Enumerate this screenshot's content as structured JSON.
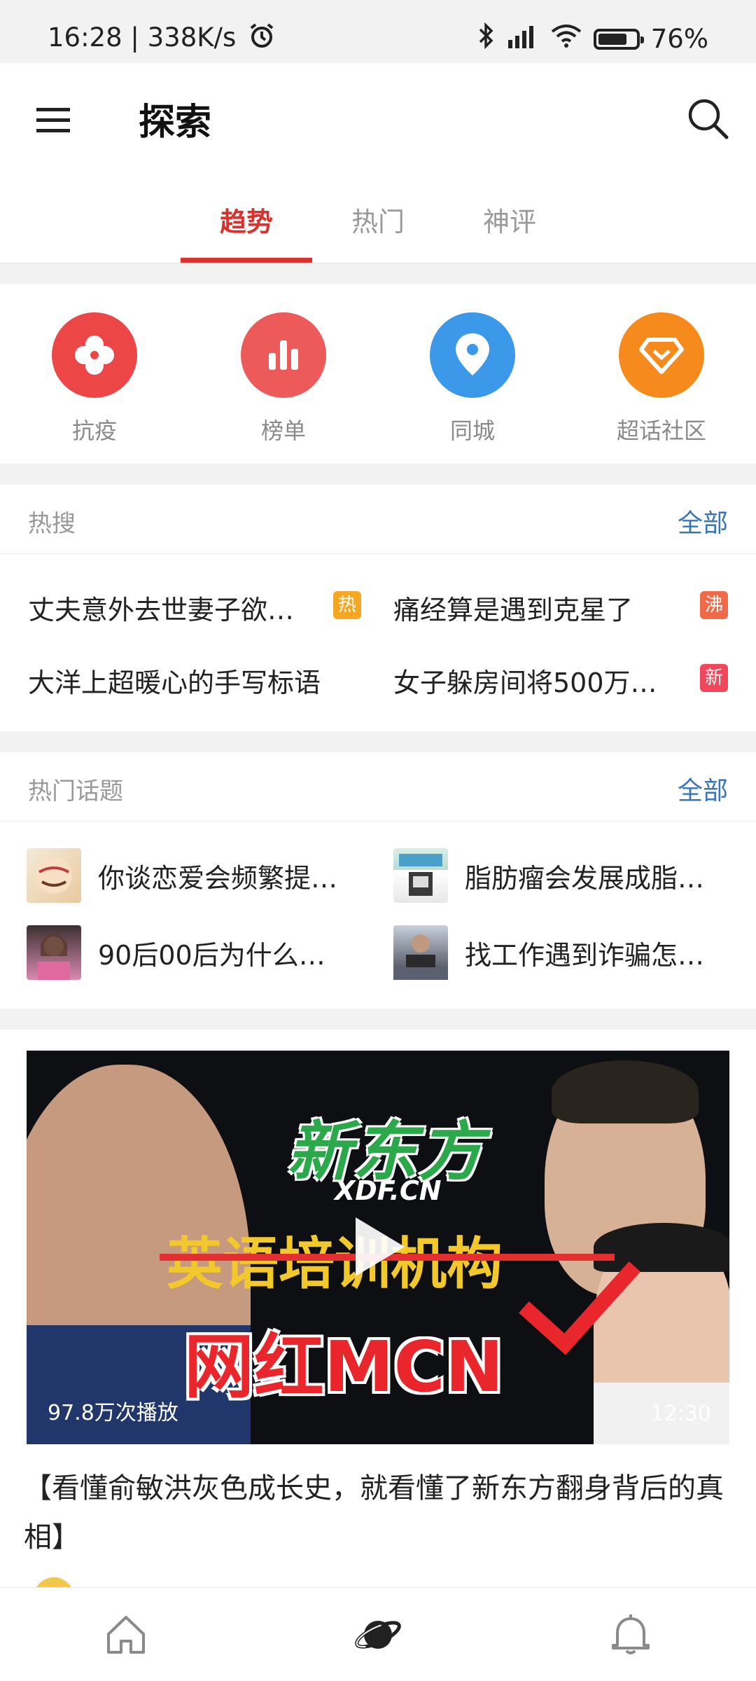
{
  "status": {
    "time": "16:28",
    "speed": "338K/s",
    "battery": "76%",
    "battery_level": 0.76
  },
  "appbar": {
    "title": "探索",
    "menu_icon": "menu-icon",
    "search_icon": "search-icon"
  },
  "tabs": [
    {
      "label": "趋势",
      "active": true
    },
    {
      "label": "热门",
      "active": false
    },
    {
      "label": "神评",
      "active": false
    }
  ],
  "quick_links": [
    {
      "label": "抗疫",
      "icon": "clover-icon",
      "color": "#ec4646"
    },
    {
      "label": "榜单",
      "icon": "bar-chart-icon",
      "color": "#ec5a5a"
    },
    {
      "label": "同城",
      "icon": "location-pin-icon",
      "color": "#3c98e8"
    },
    {
      "label": "超话社区",
      "icon": "diamond-icon",
      "color": "#f78a1c"
    }
  ],
  "hot_search": {
    "title": "热搜",
    "all_label": "全部",
    "items": [
      {
        "text": "丈夫意外去世妻子欲…",
        "badge": "热",
        "badge_color": "#f5a623"
      },
      {
        "text": "痛经算是遇到克星了",
        "badge": "沸",
        "badge_color": "#f06a4a"
      },
      {
        "text": "大洋上超暖心的手写标语",
        "badge": "",
        "badge_color": ""
      },
      {
        "text": "女子躲房间将500万…",
        "badge": "新",
        "badge_color": "#f0475d"
      }
    ]
  },
  "topics": {
    "title": "热门话题",
    "all_label": "全部",
    "items": [
      {
        "text": "你谈恋爱会频繁提…"
      },
      {
        "text": "脂肪瘤会发展成脂…"
      },
      {
        "text": "90后00后为什么…"
      },
      {
        "text": "找工作遇到诈骗怎…"
      }
    ]
  },
  "feed": {
    "video": {
      "logo": "新东方",
      "logo_sub": "XDF.CN",
      "line1": "英语培训机构",
      "line2": "网红MCN",
      "plays": "97.8万次播放",
      "duration": "12:30"
    },
    "caption": "【看懂俞敏洪灰色成长史，就看懂了新东方翻身背后的真相】"
  },
  "bottom_nav": [
    {
      "icon": "home-icon"
    },
    {
      "icon": "planet-icon",
      "active": true
    },
    {
      "icon": "bell-icon"
    }
  ]
}
